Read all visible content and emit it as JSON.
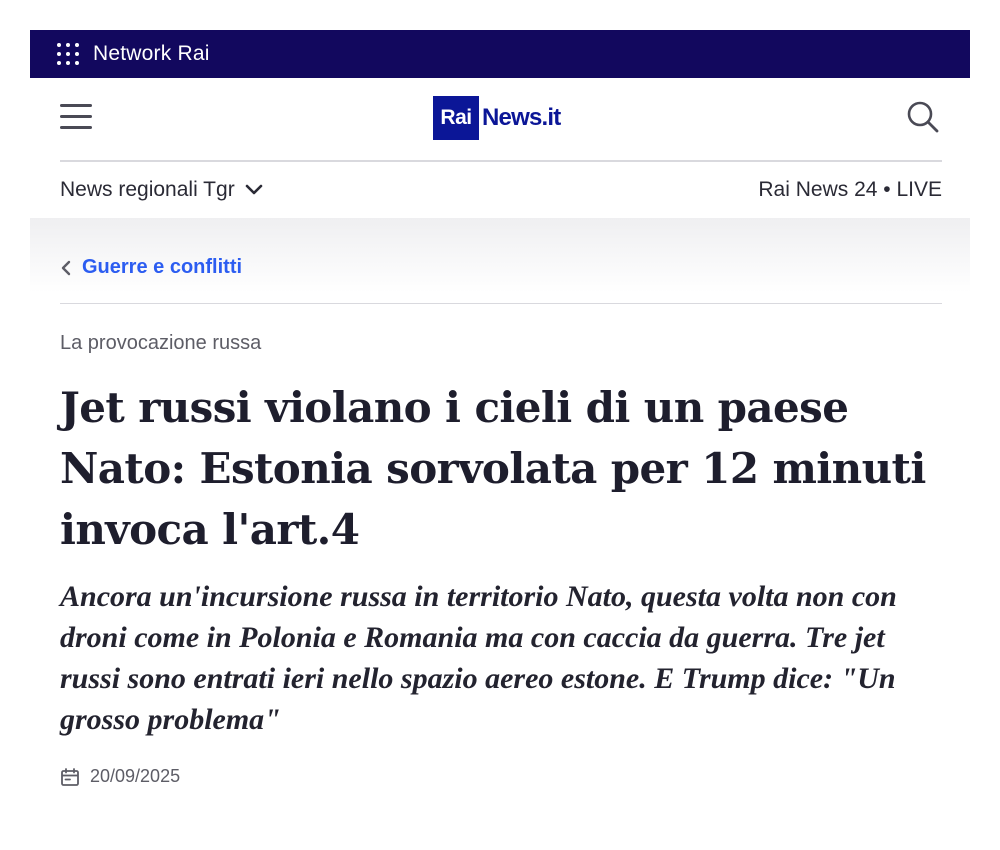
{
  "network_bar": {
    "label": "Network Rai"
  },
  "header": {
    "logo_rai": "Rai",
    "logo_news": "News.it"
  },
  "subnav": {
    "regional": "News regionali Tgr",
    "live": "Rai News 24 • LIVE"
  },
  "breadcrumb": {
    "label": "Guerre e conflitti"
  },
  "article": {
    "kicker": "La provocazione russa",
    "headline": "Jet russi violano i cieli di un paese Nato: Estonia sorvolata per 12 minuti invoca l'art.4",
    "summary": "Ancora un'incursione russa in territorio Nato, questa volta non con droni come in Polonia e Romania ma con caccia da guerra. Tre jet russi sono entrati ieri nello spazio aereo estone. E Trump dice: \"Un grosso problema\"",
    "date": "20/09/2025"
  },
  "colors": {
    "network_bar": "#12085e",
    "brand_blue": "#0b1697",
    "link_blue": "#2c5df1"
  },
  "icons": [
    "grid-icon",
    "menu-icon",
    "search-icon",
    "chevron-down-icon",
    "chevron-left-icon",
    "calendar-icon"
  ]
}
